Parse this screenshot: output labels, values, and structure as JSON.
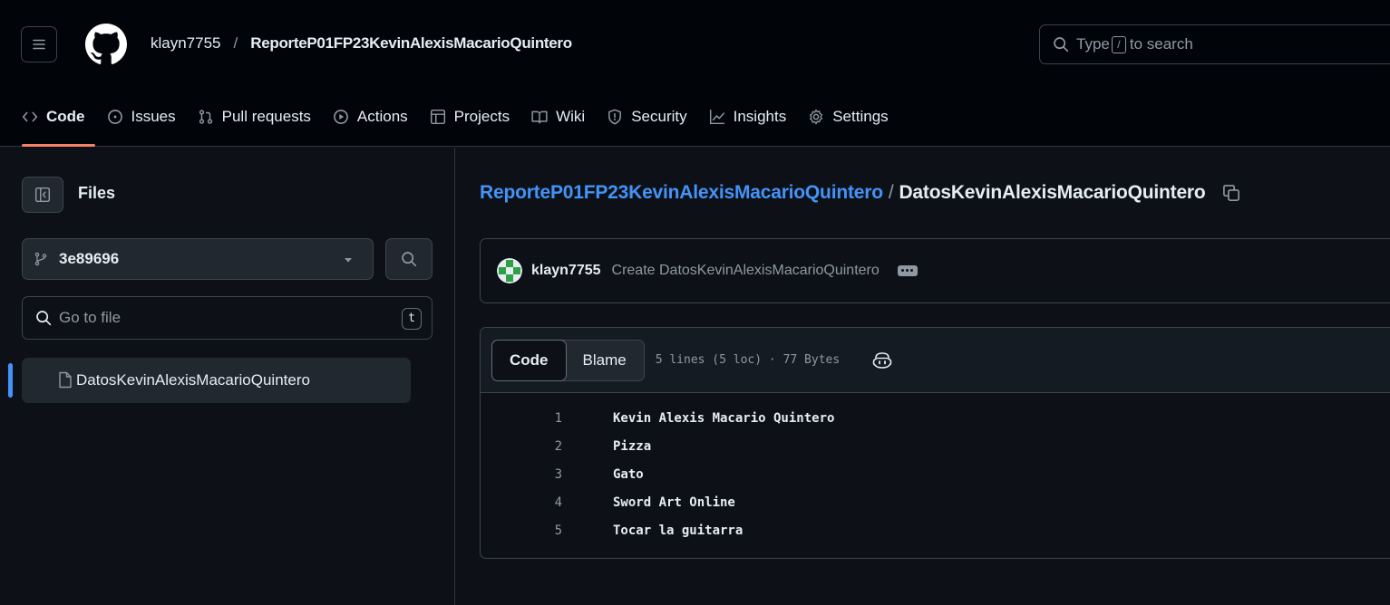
{
  "header": {
    "owner": "klayn7755",
    "separator": "/",
    "repo": "ReporteP01FP23KevinAlexisMacarioQuintero",
    "search": {
      "prefix": "Type",
      "key": "/",
      "suffix": "to search"
    }
  },
  "tabs": [
    {
      "label": "Code",
      "icon": "code-icon",
      "active": true
    },
    {
      "label": "Issues",
      "icon": "issue-icon"
    },
    {
      "label": "Pull requests",
      "icon": "pull-request-icon"
    },
    {
      "label": "Actions",
      "icon": "play-icon"
    },
    {
      "label": "Projects",
      "icon": "table-icon"
    },
    {
      "label": "Wiki",
      "icon": "book-icon"
    },
    {
      "label": "Security",
      "icon": "shield-icon"
    },
    {
      "label": "Insights",
      "icon": "graph-icon"
    },
    {
      "label": "Settings",
      "icon": "gear-icon"
    }
  ],
  "sidebar": {
    "title": "Files",
    "branch": "3e89696",
    "goto_placeholder": "Go to file",
    "goto_key": "t",
    "files": [
      {
        "name": "DatosKevinAlexisMacarioQuintero",
        "selected": true
      }
    ]
  },
  "main": {
    "path_repo": "ReporteP01FP23KevinAlexisMacarioQuintero",
    "path_sep": "/",
    "path_file": "DatosKevinAlexisMacarioQuintero",
    "commit": {
      "author": "klayn7755",
      "message": "Create DatosKevinAlexisMacarioQuintero"
    },
    "view_tabs": {
      "code": "Code",
      "blame": "Blame"
    },
    "file_meta": "5 lines (5 loc) · 77 Bytes",
    "lines": [
      {
        "n": "1",
        "text": "Kevin Alexis Macario Quintero"
      },
      {
        "n": "2",
        "text": "Pizza"
      },
      {
        "n": "3",
        "text": "Gato"
      },
      {
        "n": "4",
        "text": "Sword Art Online"
      },
      {
        "n": "5",
        "text": "Tocar la guitarra"
      }
    ]
  },
  "colors": {
    "accent_link": "#4493f8",
    "active_tab_underline": "#f78166",
    "background": "#0d1117"
  }
}
